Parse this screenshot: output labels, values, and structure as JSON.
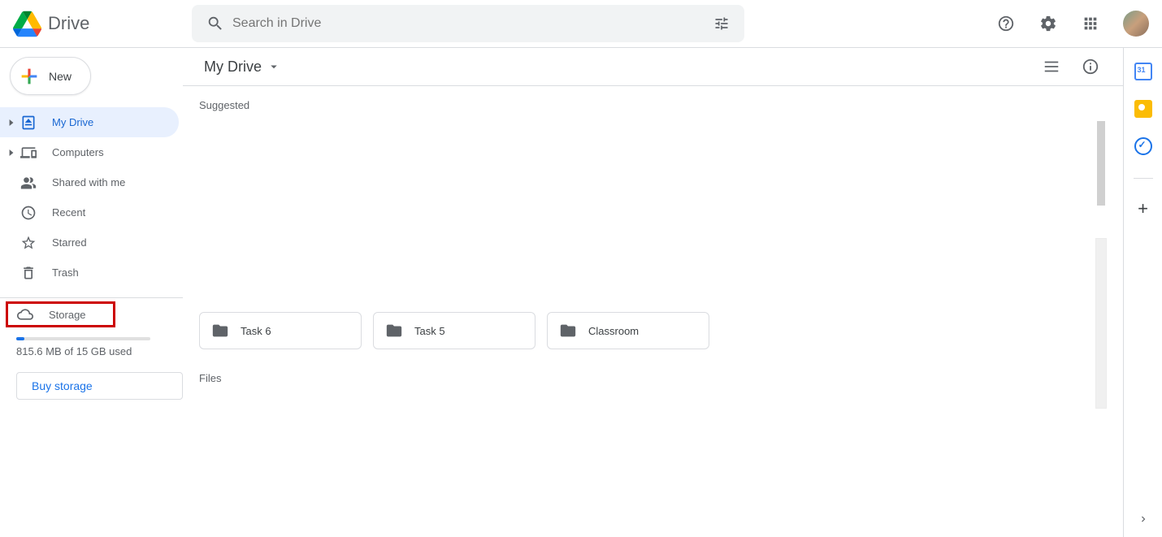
{
  "header": {
    "app_title": "Drive",
    "search_placeholder": "Search in Drive"
  },
  "sidebar": {
    "new_label": "New",
    "items": [
      {
        "label": "My Drive"
      },
      {
        "label": "Computers"
      },
      {
        "label": "Shared with me"
      },
      {
        "label": "Recent"
      },
      {
        "label": "Starred"
      },
      {
        "label": "Trash"
      }
    ],
    "storage_label": "Storage",
    "storage_text": "815.6 MB of 15 GB used",
    "buy_label": "Buy storage"
  },
  "main": {
    "breadcrumb": "My Drive",
    "suggested_label": "Suggested",
    "folders": [
      {
        "name": "Task 6"
      },
      {
        "name": "Task 5"
      },
      {
        "name": "Classroom"
      }
    ],
    "files_label": "Files"
  }
}
